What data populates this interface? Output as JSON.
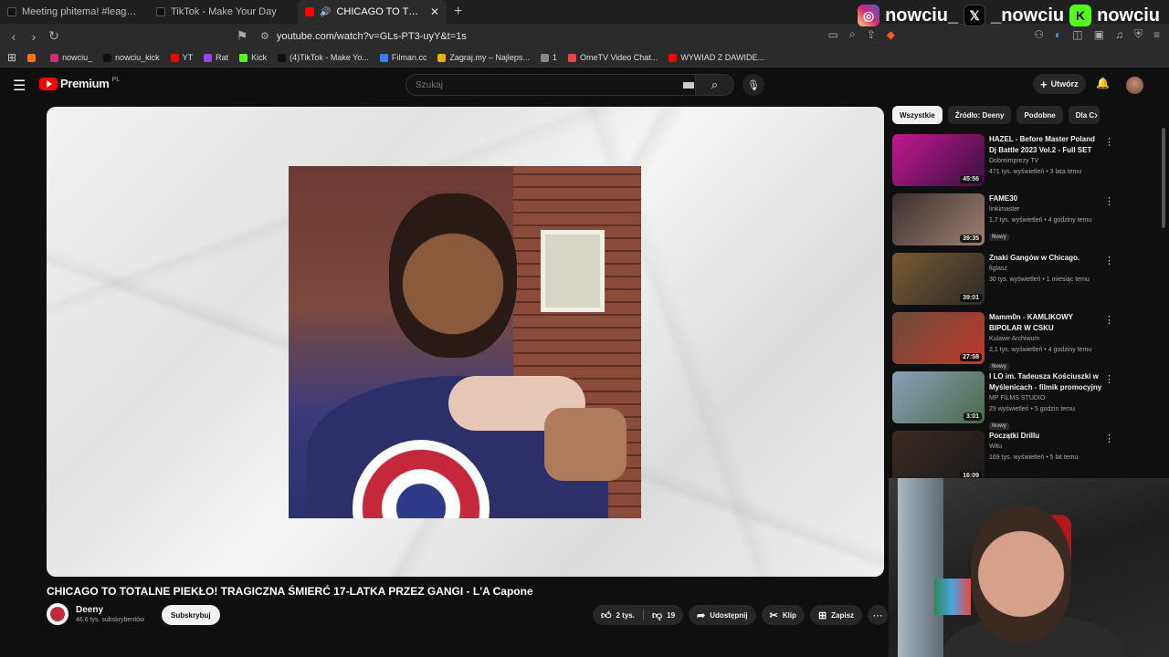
{
  "browser": {
    "tabs": [
      {
        "label": "Meeting phitema! #leagueoflegends",
        "icon_color": "#111111",
        "active": false
      },
      {
        "label": "TikTok - Make Your Day",
        "icon_color": "#111111",
        "active": false
      },
      {
        "label": "CHICAGO TO TOTALNE PIEKŁO",
        "icon_color": "#ff0000",
        "active": true
      }
    ],
    "url": "youtube.com/watch?v=GLs-PT3-uyY&t=1s",
    "bookmarks": [
      {
        "label": "",
        "color": "#f97316"
      },
      {
        "label": "nowciu_",
        "color": "#d62976"
      },
      {
        "label": "nowciu_kick",
        "color": "#111111"
      },
      {
        "label": "YT",
        "color": "#ff0000"
      },
      {
        "label": "Rat",
        "color": "#9146ff"
      },
      {
        "label": "Kick",
        "color": "#53fc18"
      },
      {
        "label": "(4)TikTok - Make Yo...",
        "color": "#111111"
      },
      {
        "label": "Filman.cc",
        "color": "#3b82f6"
      },
      {
        "label": "Zagraj.my – Najleps...",
        "color": "#eab308"
      },
      {
        "label": "1",
        "color": "#888888"
      },
      {
        "label": "OmeTV Video Chat...",
        "color": "#ef4444"
      },
      {
        "label": "WYWIAD Z DAWIDE...",
        "color": "#ff0000"
      }
    ]
  },
  "overlay": {
    "instagram": "nowciu_",
    "x": "_nowciu",
    "kick": "nowciu"
  },
  "youtube": {
    "logo": "Premium",
    "logo_country": "PL",
    "search_placeholder": "Szukaj",
    "create_label": "Utwórz"
  },
  "video": {
    "title": "CHICAGO TO TOTALNE PIEKŁO! TRAGICZNA ŚMIERĆ 17-LATKA PRZEZ GANGI - L'A Capone",
    "channel": "Deeny",
    "subscribers": "46,6 tys. subskrybentów",
    "subscribe_label": "Subskrybuj",
    "likes": "2 tys.",
    "dislikes": "19",
    "share_label": "Udostępnij",
    "clip_label": "Klip",
    "save_label": "Zapisz"
  },
  "chips": [
    "Wszystkie",
    "Źródło: Deeny",
    "Podobne",
    "Dla C"
  ],
  "recommendations": [
    {
      "title": "HAZEL - Before Master Poland Dj Battle 2023 Vol.2 - Full SET",
      "channel": "Dobreimprezy TV",
      "meta": "471 tys. wyświetleń • 3 lata temu",
      "duration": "45:56",
      "badge": "",
      "thumb": [
        "#c2188f",
        "#3a1040"
      ]
    },
    {
      "title": "FAME30",
      "channel": "linkimaster",
      "meta": "1,7 tys. wyświetleń • 4 godziny temu",
      "duration": "39:35",
      "badge": "Nowy",
      "thumb": [
        "#3a3030",
        "#a08070"
      ]
    },
    {
      "title": "Znaki Gangów w Chicago.",
      "channel": "figlasz",
      "meta": "30 tys. wyświetleń • 1 miesiąc temu",
      "duration": "39:01",
      "badge": "",
      "thumb": [
        "#7a5a30",
        "#2a2a2a"
      ]
    },
    {
      "title": "Mamm0n - KAMLIKOWY BIPOLAR W CSKU",
      "channel": "Kulawe Archiwum",
      "meta": "2,1 tys. wyświetleń • 4 godziny temu",
      "duration": "27:58",
      "badge": "Nowy",
      "thumb": [
        "#6a4a3a",
        "#c0392b"
      ]
    },
    {
      "title": "I LO im. Tadeusza Kościuszki w Myślenicach - filmik promocyjny",
      "channel": "MP FILMS STUDIO",
      "meta": "29 wyświetleń • 5 godzin temu",
      "duration": "3:01",
      "badge": "Nowy",
      "thumb": [
        "#8aa0b8",
        "#4a6a4a"
      ]
    },
    {
      "title": "Początki Drillu",
      "channel": "Witu",
      "meta": "169 tys. wyświetleń • 5 lat temu",
      "duration": "16:09",
      "badge": "",
      "thumb": [
        "#3a2a22",
        "#1a1a1a"
      ]
    }
  ]
}
